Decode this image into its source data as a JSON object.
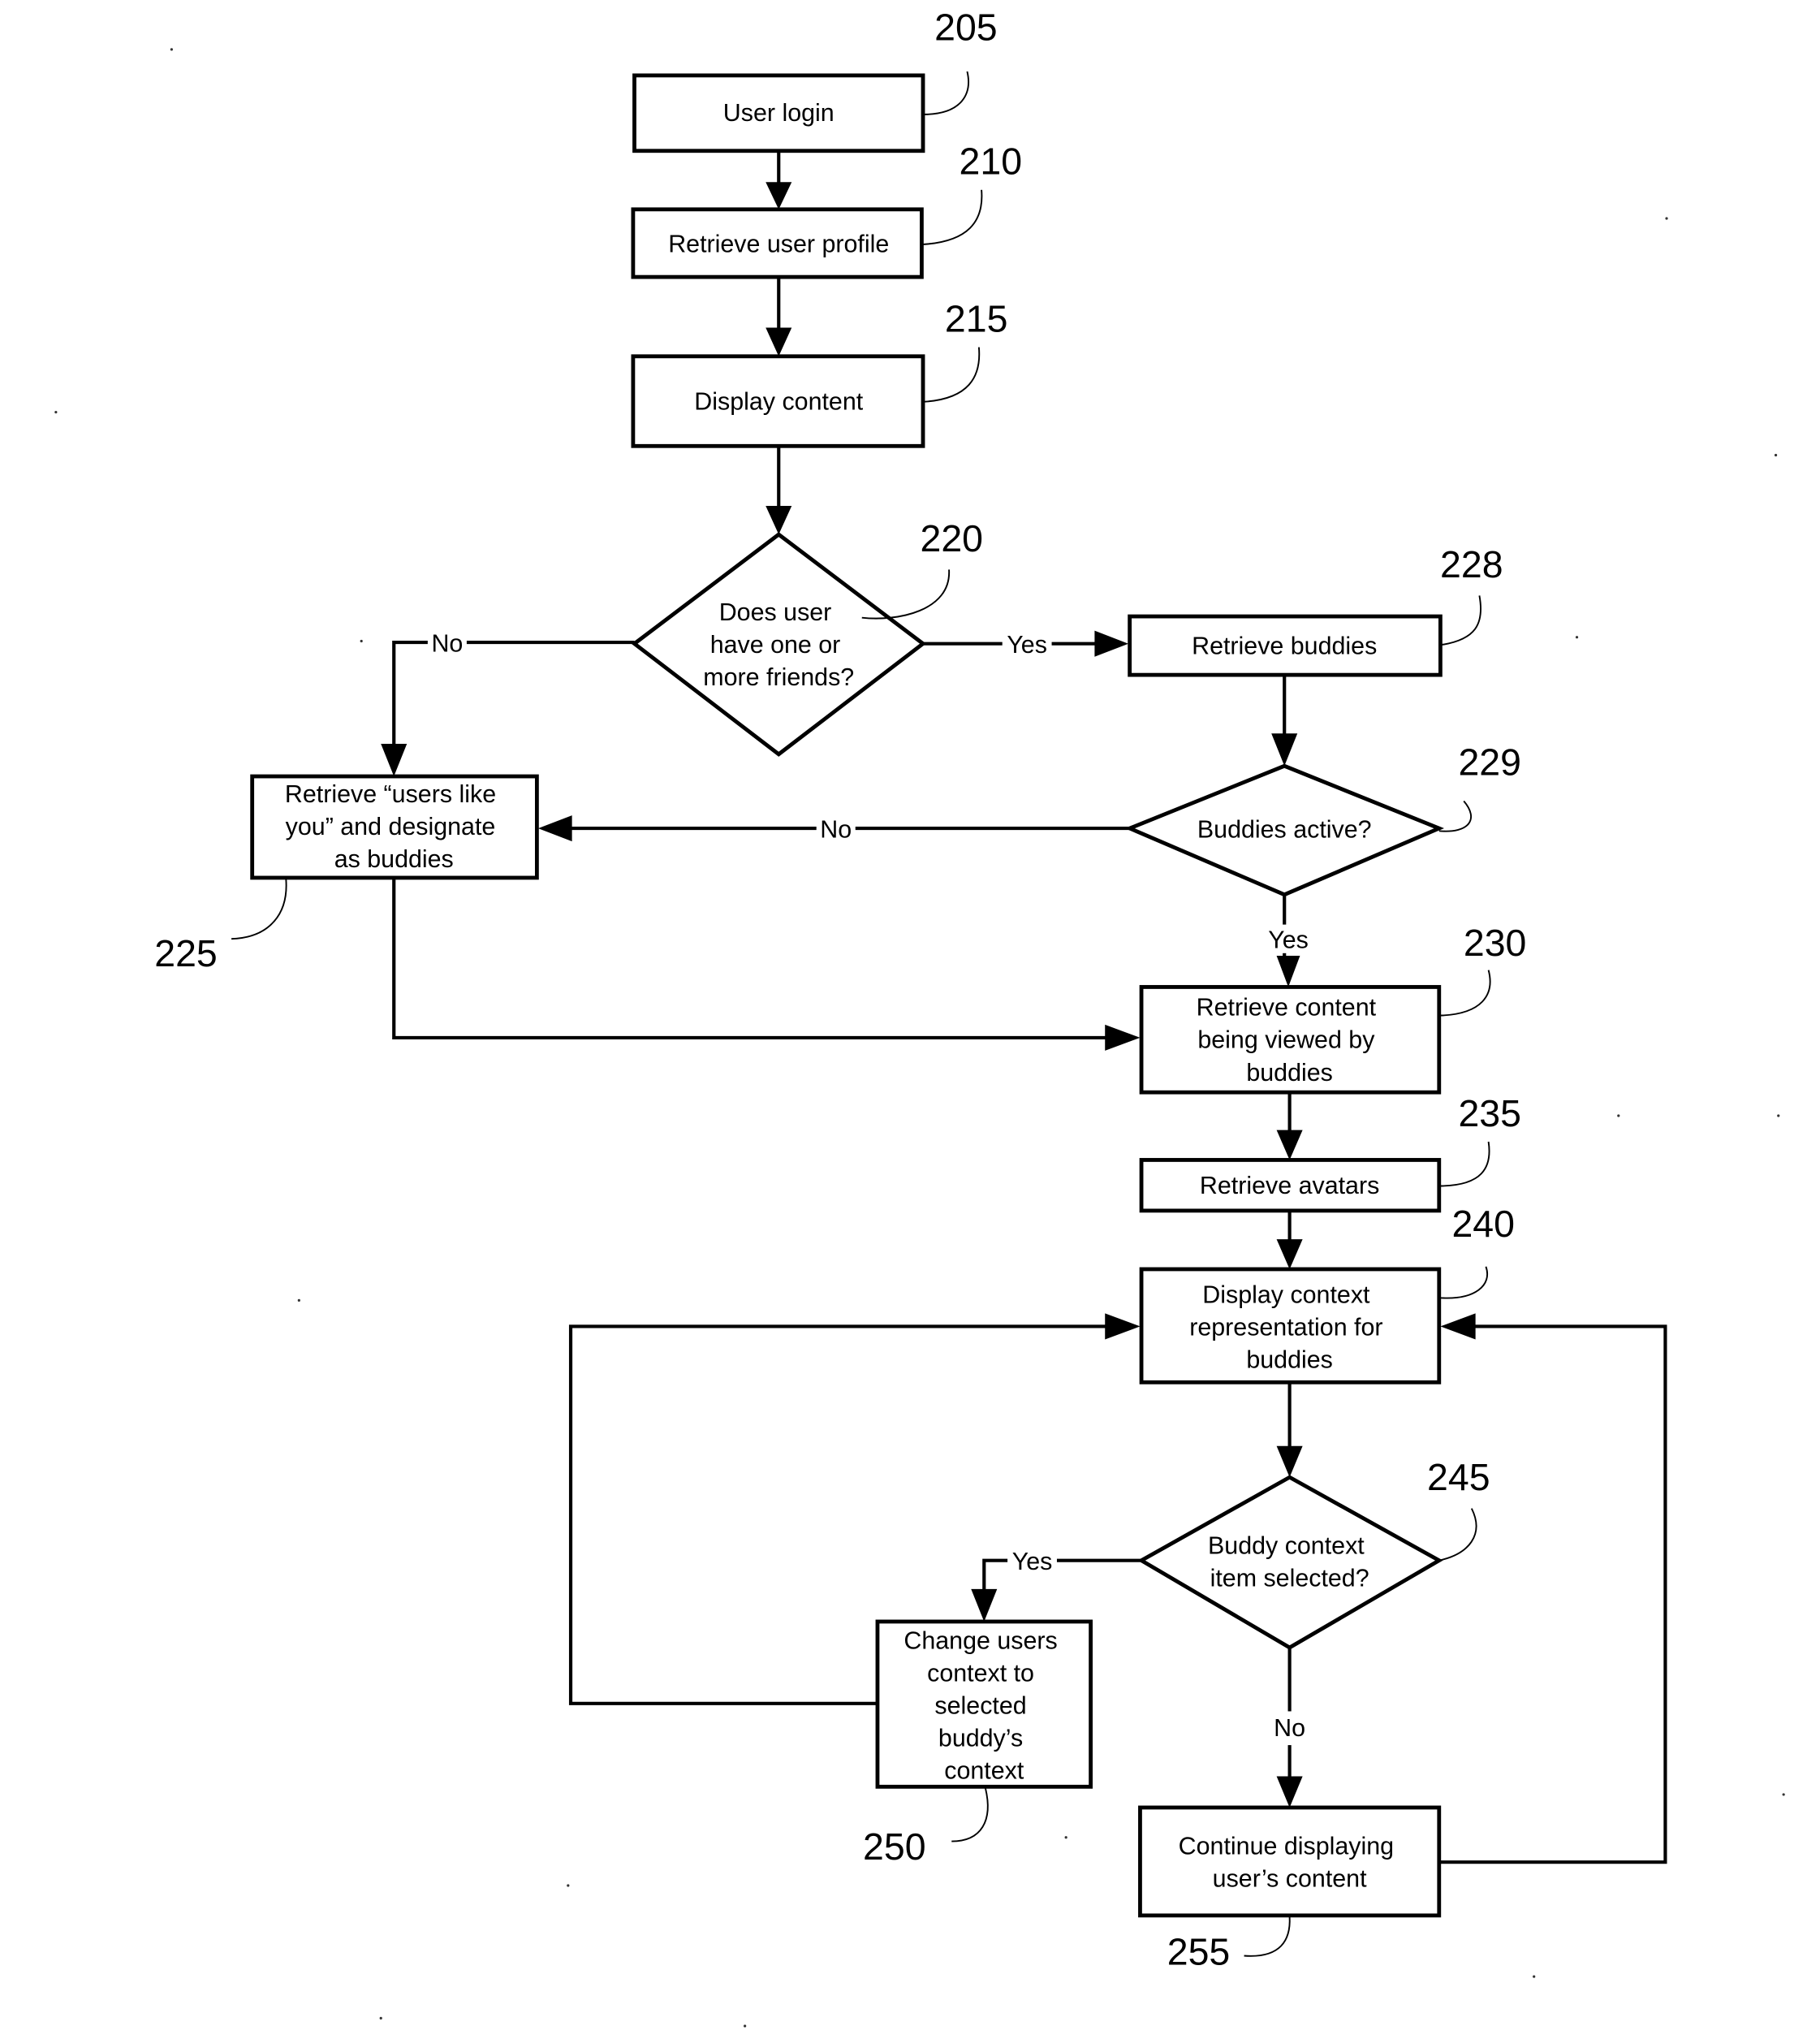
{
  "figure": {
    "type": "flowchart",
    "colors": {
      "line": "#000000",
      "background": "#ffffff",
      "fill": "#ffffff"
    }
  },
  "nodes": {
    "n205": {
      "ref": "205",
      "shape": "process",
      "lines": [
        "User login"
      ]
    },
    "n210": {
      "ref": "210",
      "shape": "process",
      "lines": [
        "Retrieve user profile"
      ]
    },
    "n215": {
      "ref": "215",
      "shape": "process",
      "lines": [
        "Display content"
      ]
    },
    "n220": {
      "ref": "220",
      "shape": "decision",
      "lines": [
        "Does user",
        "have one or",
        "more friends?"
      ]
    },
    "n225": {
      "ref": "225",
      "shape": "process",
      "lines": [
        "Retrieve “users like",
        "you” and designate",
        "as buddies"
      ]
    },
    "n228": {
      "ref": "228",
      "shape": "process",
      "lines": [
        "Retrieve buddies"
      ]
    },
    "n229": {
      "ref": "229",
      "shape": "decision",
      "lines": [
        "Buddies active?"
      ]
    },
    "n230": {
      "ref": "230",
      "shape": "process",
      "lines": [
        "Retrieve content",
        "being viewed by",
        "buddies"
      ]
    },
    "n235": {
      "ref": "235",
      "shape": "process",
      "lines": [
        "Retrieve avatars"
      ]
    },
    "n240": {
      "ref": "240",
      "shape": "process",
      "lines": [
        "Display context",
        "representation for",
        "buddies"
      ]
    },
    "n245": {
      "ref": "245",
      "shape": "decision",
      "lines": [
        "Buddy context",
        "item selected?"
      ]
    },
    "n250": {
      "ref": "250",
      "shape": "process",
      "lines": [
        "Change users",
        "context to",
        "selected",
        "buddy’s",
        "context"
      ]
    },
    "n255": {
      "ref": "255",
      "shape": "process",
      "lines": [
        "Continue displaying",
        "user’s content"
      ]
    }
  },
  "edges": [
    {
      "from": "205",
      "to": "210",
      "label": ""
    },
    {
      "from": "210",
      "to": "215",
      "label": ""
    },
    {
      "from": "215",
      "to": "220",
      "label": ""
    },
    {
      "from": "220",
      "to": "228",
      "label": "Yes"
    },
    {
      "from": "220",
      "to": "225",
      "label": "No"
    },
    {
      "from": "228",
      "to": "229",
      "label": ""
    },
    {
      "from": "229",
      "to": "225",
      "label": "No"
    },
    {
      "from": "229",
      "to": "230",
      "label": "Yes"
    },
    {
      "from": "225",
      "to": "230",
      "label": ""
    },
    {
      "from": "230",
      "to": "235",
      "label": ""
    },
    {
      "from": "235",
      "to": "240",
      "label": ""
    },
    {
      "from": "240",
      "to": "245",
      "label": ""
    },
    {
      "from": "245",
      "to": "250",
      "label": "Yes"
    },
    {
      "from": "245",
      "to": "255",
      "label": "No"
    },
    {
      "from": "250",
      "to": "240",
      "label": ""
    },
    {
      "from": "255",
      "to": "240",
      "label": ""
    }
  ],
  "edge_labels": {
    "e220_yes": "Yes",
    "e220_no": "No",
    "e229_no": "No",
    "e229_yes": "Yes",
    "e245_yes": "Yes",
    "e245_no": "No"
  }
}
